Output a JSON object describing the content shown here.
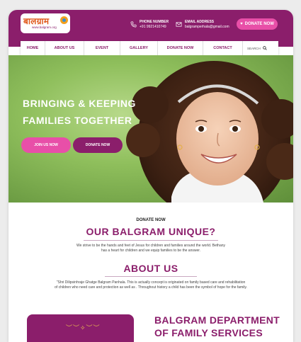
{
  "colors": {
    "brand": "#8b1e6b",
    "accent": "#e84fa8"
  },
  "logo": {
    "text": "बालग्राम",
    "tagline": "www.balgram.org"
  },
  "header": {
    "phone_label": "PHONE NUMBER",
    "phone_value": "+91 9921410749",
    "email_label": "EMAIL ADDRESS",
    "email_value": "balgramperhala@gmail.com",
    "donate_label": "DONATE NOW"
  },
  "nav": {
    "items": [
      "HOME",
      "ABOUT US",
      "EVENT",
      "GALLERY",
      "DONATE NOW",
      "CONTACT"
    ],
    "search_label": "SEARCH"
  },
  "hero": {
    "title_line1": "BRINGING & KEEPING",
    "title_line2": "FAMILIES TOGETHER",
    "join_label": "JOIN US NOW",
    "donate_label": "DONATE NOW"
  },
  "unique": {
    "kicker": "DONATE NOW",
    "title": "OUR BALGRAM UNIQUE?",
    "text_line1": "We strive to be the hands and feet of Jesus for children and families around the world. Bethany",
    "text_line2": "has a heart for children and we equip families to be the answer."
  },
  "about": {
    "title": "ABOUT US",
    "text_line1": "\"Shri Dilipsinhraje Ghatge Balgram Panhala. This is actually concept is originated on family based care and rehabilitation",
    "text_line2": "of children who need care and protection as well as . Throughout history a child has been the symbol of hope for the family."
  },
  "department": {
    "title_line1": "BALGRAM DEPARTMENT",
    "title_line2": "OF FAMILY SERVICES"
  }
}
